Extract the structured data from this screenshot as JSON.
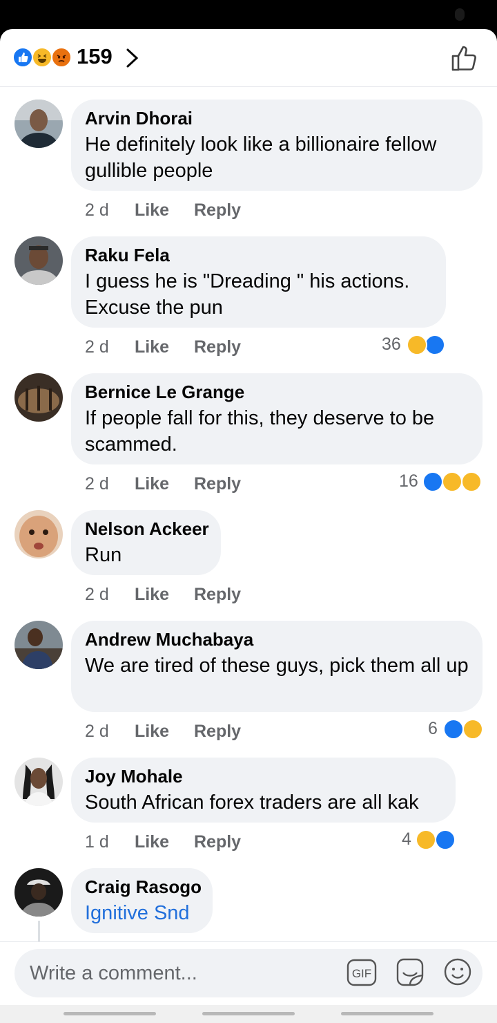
{
  "header": {
    "reaction_count": "159",
    "reactions": [
      "like-icon",
      "haha-icon",
      "angry-icon"
    ]
  },
  "comments": [
    {
      "author": "Arvin Dhorai",
      "text": "He definitely look like a billionaire fellow gullible people",
      "time": "2 d",
      "like": "Like",
      "reply": "Reply",
      "reaction_count": "",
      "reactions": []
    },
    {
      "author": "Raku Fela",
      "text": "I guess he is  \"Dreading \" his actions. Excuse the pun",
      "time": "2 d",
      "like": "Like",
      "reply": "Reply",
      "reaction_count": "36",
      "reactions": [
        "haha-icon",
        "like-icon"
      ]
    },
    {
      "author": "Bernice Le Grange",
      "text": "If people fall for this, they deserve to be scammed.",
      "time": "2 d",
      "like": "Like",
      "reply": "Reply",
      "reaction_count": "16",
      "reactions": [
        "like-icon",
        "haha-icon",
        "sad-icon"
      ]
    },
    {
      "author": "Nelson Ackeer",
      "text": "Run",
      "time": "2 d",
      "like": "Like",
      "reply": "Reply",
      "reaction_count": "",
      "reactions": []
    },
    {
      "author": "Andrew Muchabaya",
      "text": "We are tired of these guys, pick them all up",
      "time": "2 d",
      "like": "Like",
      "reply": "Reply",
      "reaction_count": "6",
      "reactions": [
        "like-icon",
        "haha-icon"
      ]
    },
    {
      "author": "Joy Mohale",
      "text": "South African forex traders are all kak",
      "time": "1 d",
      "like": "Like",
      "reply": "Reply",
      "reaction_count": "4",
      "reactions": [
        "haha-icon",
        "like-icon"
      ]
    },
    {
      "author": "Craig Rasogo",
      "text": "Ignitive Snd",
      "time": "",
      "like": "",
      "reply": "",
      "reaction_count": "",
      "reactions": []
    }
  ],
  "composer": {
    "placeholder": "Write a comment...",
    "gif_label": "GIF"
  },
  "colors": {
    "like_blue": "#1877f2",
    "haha_yellow": "#f7b928",
    "angry_orange": "#e9710f",
    "bubble_gray": "#f0f2f5",
    "secondary_text": "#65676b",
    "mention_link": "#216fdb"
  }
}
